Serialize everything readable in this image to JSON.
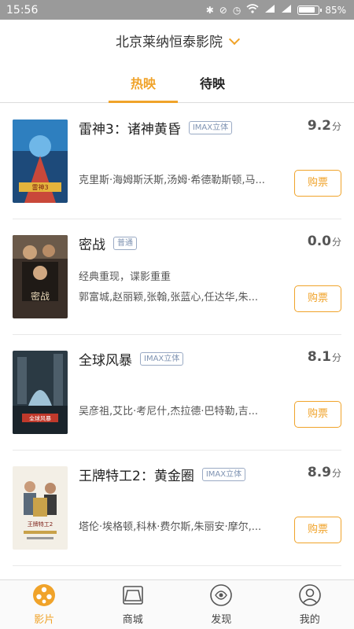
{
  "status_bar": {
    "time": "15:56",
    "battery": "85%"
  },
  "header": {
    "cinema_name": "北京莱纳恒泰影院",
    "tabs": [
      {
        "label": "热映"
      },
      {
        "label": "待映"
      }
    ]
  },
  "movies": [
    {
      "title": "雷神3：诸神黄昏",
      "tag": "IMAX立体",
      "score": "9.2",
      "score_unit": "分",
      "desc": "",
      "cast": "克里斯·海姆斯沃斯,汤姆·希德勒斯顿,马...",
      "buy_label": "购票",
      "poster_text": "雷神3"
    },
    {
      "title": "密战",
      "tag": "普通",
      "score": "0.0",
      "score_unit": "分",
      "desc": "经典重现，谍影重重",
      "cast": "郭富城,赵丽颖,张翰,张蓝心,任达华,朱...",
      "buy_label": "购票",
      "poster_text": "密战"
    },
    {
      "title": "全球风暴",
      "tag": "IMAX立体",
      "score": "8.1",
      "score_unit": "分",
      "desc": "",
      "cast": "吴彦祖,艾比·考尼什,杰拉德·巴特勒,吉...",
      "buy_label": "购票",
      "poster_text": "全球风暴"
    },
    {
      "title": "王牌特工2：黄金圈",
      "tag": "IMAX立体",
      "score": "8.9",
      "score_unit": "分",
      "desc": "",
      "cast": "塔伦·埃格顿,科林·费尔斯,朱丽安·摩尔,...",
      "buy_label": "购票",
      "poster_text": "王牌特工2"
    }
  ],
  "bottom_nav": [
    {
      "label": "影片",
      "icon": "film-reel-icon"
    },
    {
      "label": "商城",
      "icon": "shop-icon"
    },
    {
      "label": "发现",
      "icon": "discover-icon"
    },
    {
      "label": "我的",
      "icon": "profile-icon"
    }
  ],
  "colors": {
    "accent": "#f0a32a",
    "status_bar": "#9a9a9a"
  }
}
